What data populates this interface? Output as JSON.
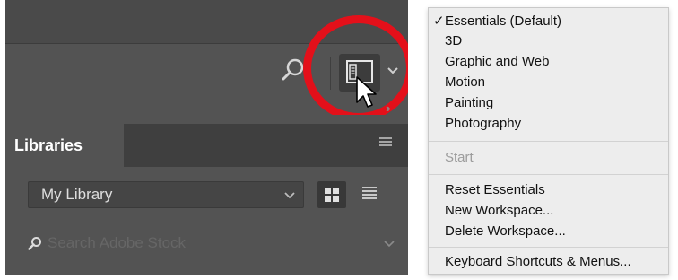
{
  "toolbar": {
    "search_icon": "search-icon",
    "workspace_icon": "workspace-layout-icon",
    "chevron_icon": "chevron-down-icon",
    "highlight_color": "#e3101a"
  },
  "libraries_panel": {
    "tab_label": "Libraries",
    "library_select_value": "My Library",
    "stock_search_placeholder": "Search Adobe Stock"
  },
  "workspace_menu": {
    "checkmark": "✓",
    "items": [
      {
        "label": "Essentials (Default)",
        "checked": true,
        "enabled": true
      },
      {
        "label": "3D",
        "enabled": true
      },
      {
        "label": "Graphic and Web",
        "enabled": true
      },
      {
        "label": "Motion",
        "enabled": true
      },
      {
        "label": "Painting",
        "enabled": true
      },
      {
        "label": "Photography",
        "enabled": true
      },
      {
        "label": "Start",
        "enabled": false
      },
      {
        "label": "Reset Essentials",
        "enabled": true
      },
      {
        "label": "New Workspace...",
        "enabled": true
      },
      {
        "label": "Delete Workspace...",
        "enabled": true
      },
      {
        "label": "Keyboard Shortcuts & Menus...",
        "enabled": true
      }
    ]
  }
}
